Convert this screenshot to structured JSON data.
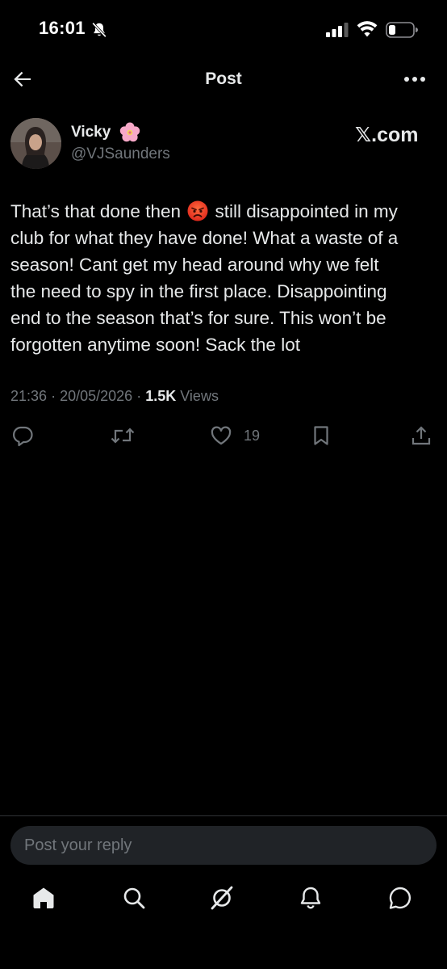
{
  "status_bar": {
    "time": "16:01",
    "icons": [
      "bell-off-icon",
      "signal-icon",
      "wifi-icon",
      "battery-icon"
    ]
  },
  "header": {
    "title": "Post",
    "back_icon": "arrow-left-icon",
    "more_icon": "more-horizontal-icon"
  },
  "author": {
    "name": "Vicky",
    "name_emoji": "cherry-blossom-icon",
    "handle": "@VJSaunders"
  },
  "watermark": "𝕏.com",
  "post": {
    "line1_before_emoji": "That’s that done then",
    "line1_emoji": "angry-face-icon",
    "line1_after_emoji": "still disappointed in my",
    "lines": [
      "club for what they have done! What a waste of a",
      "season! Cant get my head around why we felt",
      "the need to spy in the first place. Disappointing",
      "end to the season that’s for sure. This won’t be",
      "forgotten anytime soon! Sack the lot"
    ],
    "time": "21:36",
    "date": "20/05/2026",
    "views_count": "1.5K",
    "views_label": "Views",
    "separator": "·"
  },
  "actions": {
    "reply_icon": "reply-icon",
    "repost_icon": "repost-icon",
    "like_icon": "heart-icon",
    "like_count": "19",
    "bookmark_icon": "bookmark-icon",
    "share_icon": "share-icon"
  },
  "reply": {
    "placeholder": "Post your reply"
  },
  "tab_bar": {
    "items": [
      "home-icon",
      "search-icon",
      "grok-icon",
      "notifications-icon",
      "messages-icon"
    ]
  },
  "colors": {
    "background": "#000000",
    "text": "#e7e9ea",
    "secondary": "#71767b",
    "reply_box": "#202327"
  }
}
